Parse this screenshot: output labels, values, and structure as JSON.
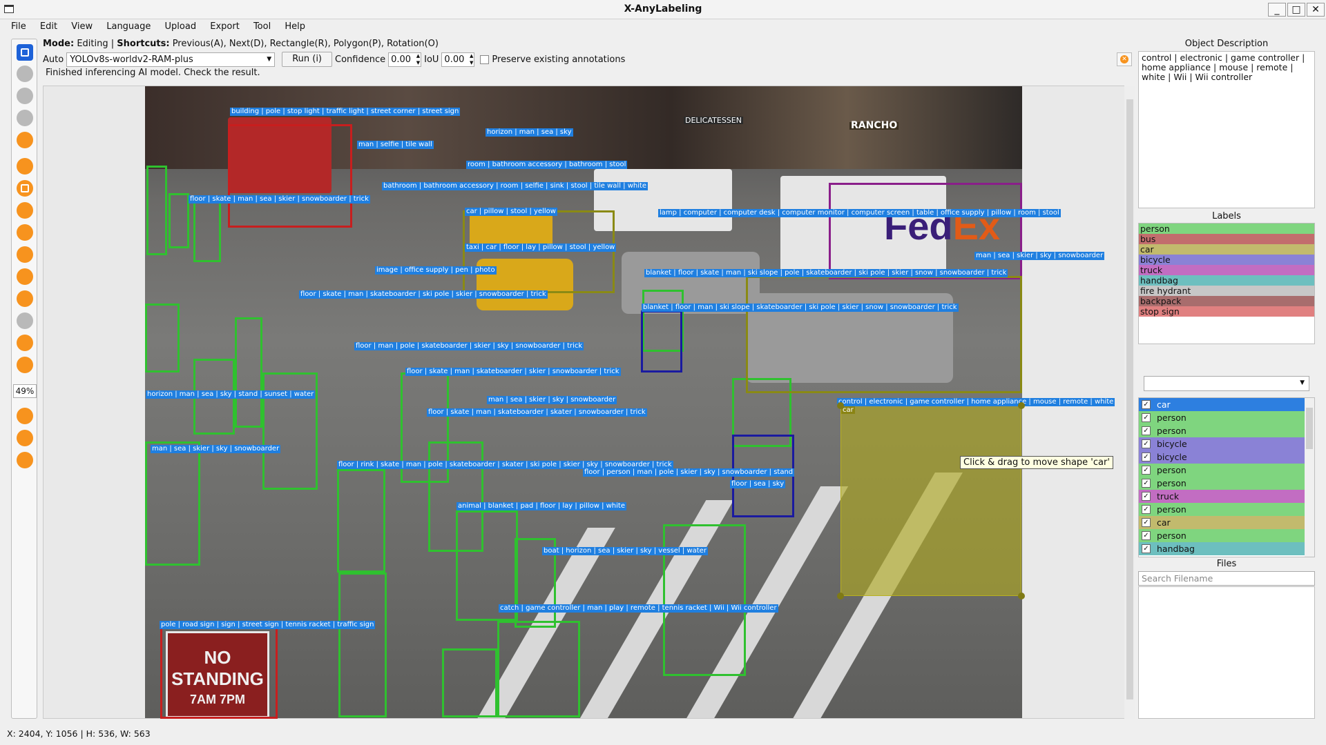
{
  "window": {
    "title": "X-AnyLabeling",
    "min": "_",
    "max": "□",
    "close": "✕"
  },
  "menu": [
    "File",
    "Edit",
    "View",
    "Language",
    "Upload",
    "Export",
    "Tool",
    "Help"
  ],
  "mode_line": {
    "mode_label": "Mode:",
    "mode_value": " Editing | ",
    "shortcuts_label": "Shortcuts:",
    "shortcuts_value": " Previous(A), Next(D), Rectangle(R), Polygon(P), Rotation(O)"
  },
  "auto": {
    "label": "Auto",
    "model": "YOLOv8s-worldv2-RAM-plus",
    "run_button": "Run (i)",
    "confidence_label": "Confidence",
    "confidence_value": "0.00",
    "iou_label": "IoU",
    "iou_value": "0.00",
    "preserve_label": "Preserve existing annotations"
  },
  "status_message": "Finished inferencing AI model. Check the result.",
  "zoom": "49%",
  "tooltip": "Click & drag to move shape 'car'",
  "selected_shape_tags": "control | electronic | game controller | home appliance | mouse | remote | white",
  "selected_shape_class": "car",
  "photo_sign": "NO STANDING",
  "photo_sign_sub": "7AM 7PM",
  "photo_brand_a": "Fed",
  "photo_brand_b": "Ex",
  "photo_store_a": "DELICATESSEN",
  "photo_store_b": "RANCHO",
  "object_description": {
    "title": "Object Description",
    "text": "control | electronic | game controller | home appliance | mouse | remote | white | Wii | Wii controller"
  },
  "labels": {
    "title": "Labels",
    "items": [
      {
        "name": "person",
        "color": "#7fd57f"
      },
      {
        "name": "bus",
        "color": "#c26d6d"
      },
      {
        "name": "car",
        "color": "#c2ba6d"
      },
      {
        "name": "bicycle",
        "color": "#8a82d6"
      },
      {
        "name": "truck",
        "color": "#c26dc2"
      },
      {
        "name": "handbag",
        "color": "#6dbfbf"
      },
      {
        "name": "fire hydrant",
        "color": "#c7c7c7"
      },
      {
        "name": "backpack",
        "color": "#a86d6d"
      },
      {
        "name": "stop sign",
        "color": "#e08080"
      }
    ]
  },
  "shapes": [
    {
      "name": "car",
      "color": "#2d7fe0",
      "selected": true
    },
    {
      "name": "person",
      "color": "#7fd57f"
    },
    {
      "name": "person",
      "color": "#7fd57f"
    },
    {
      "name": "bicycle",
      "color": "#8a82d6"
    },
    {
      "name": "bicycle",
      "color": "#8a82d6"
    },
    {
      "name": "person",
      "color": "#7fd57f"
    },
    {
      "name": "person",
      "color": "#7fd57f"
    },
    {
      "name": "truck",
      "color": "#c26dc2"
    },
    {
      "name": "person",
      "color": "#7fd57f"
    },
    {
      "name": "car",
      "color": "#c2ba6d"
    },
    {
      "name": "person",
      "color": "#7fd57f"
    },
    {
      "name": "handbag",
      "color": "#6dbfbf"
    }
  ],
  "files": {
    "title": "Files",
    "search_placeholder": "Search Filename"
  },
  "statusbar": "X: 2404, Y: 1056 | H: 536, W: 563"
}
